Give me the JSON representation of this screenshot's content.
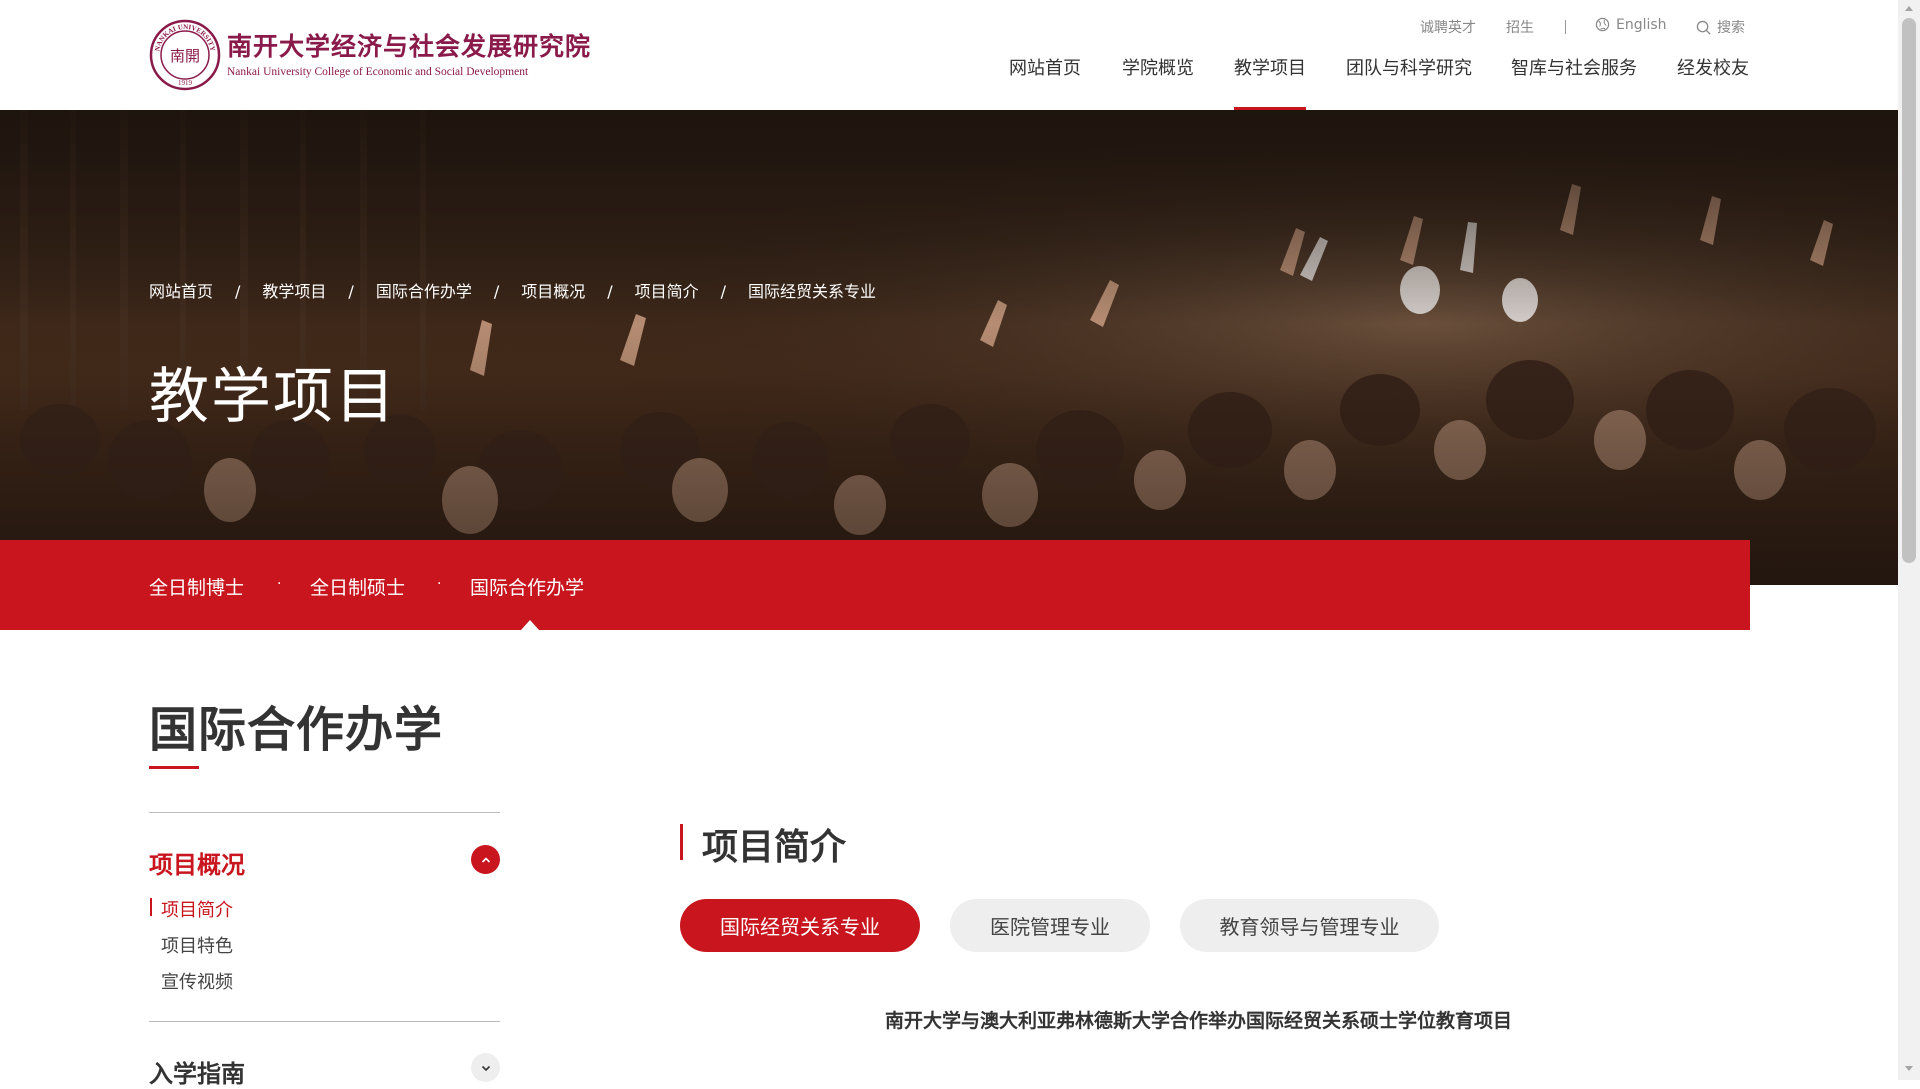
{
  "logo": {
    "name_cn": "南开大学经济与社会发展研究院",
    "name_en": "Nankai University College of Economic and Social Development",
    "seal_top": "NANKAI UNIVERSITY",
    "seal_center": "南開",
    "seal_year": "1919"
  },
  "utility": {
    "careers": "诚聘英才",
    "admissions": "招生",
    "language": "English",
    "search": "搜索"
  },
  "nav": {
    "items": [
      {
        "label": "网站首页"
      },
      {
        "label": "学院概览"
      },
      {
        "label": "教学项目",
        "active": true
      },
      {
        "label": "团队与科学研究"
      },
      {
        "label": "智库与社会服务"
      },
      {
        "label": "经发校友"
      }
    ]
  },
  "breadcrumb": [
    "网站首页",
    "教学项目",
    "国际合作办学",
    "项目概况",
    "项目简介",
    "国际经贸关系专业"
  ],
  "breadcrumb_sep": "/",
  "banner": {
    "title": "教学项目"
  },
  "subnav": {
    "items": [
      "全日制博士",
      "全日制硕士",
      "国际合作办学"
    ],
    "dot": "·"
  },
  "section": {
    "title": "国际合作办学"
  },
  "sidebar": {
    "group1": {
      "title": "项目概况",
      "expanded": true,
      "items": [
        "项目简介",
        "项目特色",
        "宣传视频"
      ],
      "active": "项目简介"
    },
    "group2": {
      "title": "入学指南",
      "expanded": false
    }
  },
  "content": {
    "heading": "项目简介",
    "tabs": [
      "国际经贸关系专业",
      "医院管理专业",
      "教育领导与管理专业"
    ],
    "active_tab": "国际经贸关系专业",
    "article_title": "南开大学与澳大利亚弗林德斯大学合作举办国际经贸关系硕士学位教育项目"
  },
  "colors": {
    "accent": "#c8151e",
    "logo": "#8a1a4a",
    "banner_dark": "#2a1d14"
  },
  "icons": {
    "globe": "globe-icon",
    "search": "search-icon",
    "chevron_up": "chevron-up-icon",
    "chevron_down": "chevron-down-icon"
  }
}
